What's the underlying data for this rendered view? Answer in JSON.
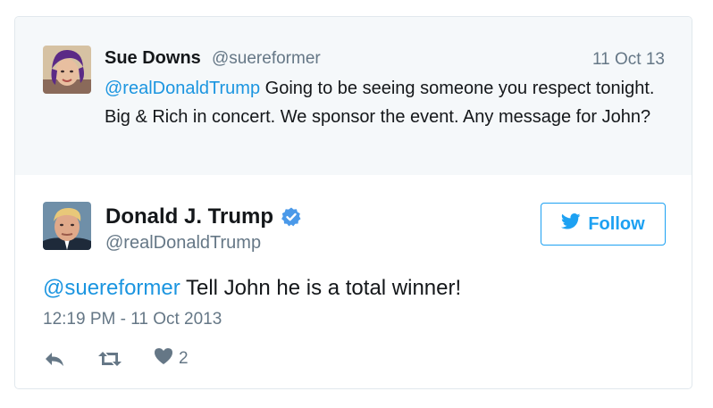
{
  "reply": {
    "name": "Sue Downs",
    "handle": "@suereformer",
    "date": "11 Oct 13",
    "mention": "@realDonaldTrump",
    "text": " Going to be seeing someone you respect tonight. Big & Rich in concert. We sponsor the event. Any message for John?"
  },
  "tweet": {
    "name": "Donald J. Trump",
    "handle": "@realDonaldTrump",
    "follow_label": "Follow",
    "mention": "@suereformer",
    "text": " Tell John he is a total winner!",
    "timestamp": "12:19 PM - 11 Oct 2013",
    "like_count": "2"
  },
  "colors": {
    "accent": "#1da1f2",
    "mention": "#1b95e0",
    "muted": "#657786",
    "reply_bg": "#f5f8fa"
  },
  "icons": [
    "verified-badge-icon",
    "bird-icon",
    "reply-icon",
    "retweet-icon",
    "heart-icon"
  ]
}
